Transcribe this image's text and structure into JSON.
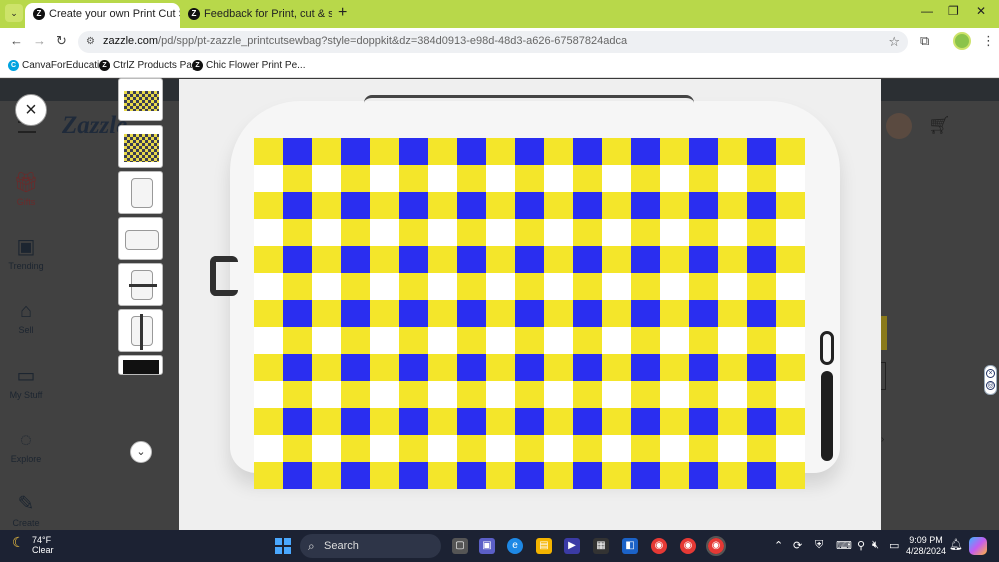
{
  "browser": {
    "tabs": [
      {
        "label": "Create your own Print Cut Sew",
        "active": true
      },
      {
        "label": "Feedback for Print, cut & sew b",
        "active": false
      }
    ],
    "url_host": "zazzle.com",
    "url_path": "/pd/spp/pt-zazzle_printcutsewbag?style=doppkit&dz=384d0913-e98d-48d3-a626-67587824adca",
    "bookmarks": [
      "CanvaForEducation",
      "CtrlZ Products Page",
      "Chic Flower Print Pe..."
    ]
  },
  "page": {
    "logo": "Zazzle",
    "sidebar": [
      {
        "label": "Gifts",
        "icon": "gift-icon"
      },
      {
        "label": "Trending",
        "icon": "trending-icon"
      },
      {
        "label": "Sell",
        "icon": "store-icon"
      },
      {
        "label": "My Stuff",
        "icon": "folder-icon"
      },
      {
        "label": "Explore",
        "icon": "lightbulb-icon"
      },
      {
        "label": "Create",
        "icon": "pen-icon"
      }
    ]
  },
  "lightbox": {
    "close_label": "×",
    "product": "doppkit",
    "pattern_colors": {
      "blue": "#2a2ef0",
      "yellow": "#f4e62a",
      "white": "#ffffff"
    }
  },
  "taskbar": {
    "weather_temp": "74°F",
    "weather_desc": "Clear",
    "search_label": "Search",
    "time": "9:09 PM",
    "date": "4/28/2024"
  }
}
